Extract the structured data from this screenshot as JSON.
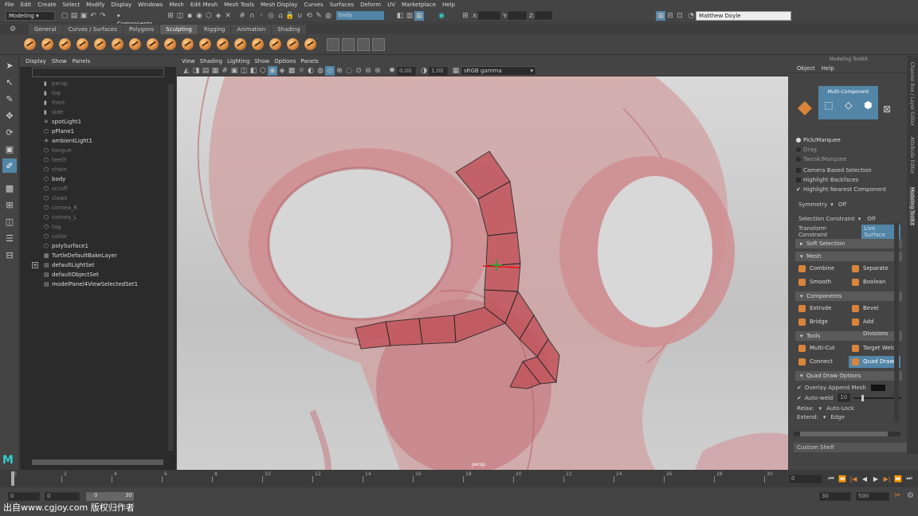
{
  "menus": [
    "File",
    "Edit",
    "Create",
    "Select",
    "Modify",
    "Display",
    "Windows",
    "Mesh",
    "Edit Mesh",
    "Mesh Tools",
    "Mesh Display",
    "Curves",
    "Surfaces",
    "Deform",
    "UV",
    "Marketplace",
    "Help"
  ],
  "status": {
    "workspace": "Modeling",
    "select_mode": "Components",
    "object_field": "body",
    "coord_x_label": "X:",
    "coord_y_label": "Y:",
    "coord_z_label": "Z:",
    "user": "Matthew Doyle"
  },
  "shelf_tabs": [
    "General",
    "Curves / Surfaces",
    "Polygons",
    "Sculpting",
    "Rigging",
    "Animation",
    "Shading"
  ],
  "shelf_active_tab": "Sculpting",
  "outliner": {
    "menus": [
      "Display",
      "Show",
      "Panels"
    ],
    "items": [
      {
        "label": "persp",
        "dim": true,
        "icon": "camera-icon"
      },
      {
        "label": "top",
        "dim": true,
        "icon": "camera-icon"
      },
      {
        "label": "front",
        "dim": true,
        "icon": "camera-icon"
      },
      {
        "label": "side",
        "dim": true,
        "icon": "camera-icon"
      },
      {
        "label": "spotLight1",
        "dim": false,
        "icon": "spotlight-icon"
      },
      {
        "label": "pPlane1",
        "dim": false,
        "icon": "mesh-icon"
      },
      {
        "label": "ambientLight1",
        "dim": false,
        "icon": "sun-icon"
      },
      {
        "label": "tongue",
        "dim": true,
        "icon": "mesh-icon"
      },
      {
        "label": "teeth",
        "dim": true,
        "icon": "mesh-icon"
      },
      {
        "label": "chain",
        "dim": true,
        "icon": "mesh-icon"
      },
      {
        "label": "body",
        "dim": false,
        "icon": "mesh-icon"
      },
      {
        "label": "scruff",
        "dim": true,
        "icon": "mesh-icon"
      },
      {
        "label": "claws",
        "dim": true,
        "icon": "mesh-icon"
      },
      {
        "label": "cornea_R",
        "dim": true,
        "icon": "mesh-icon"
      },
      {
        "label": "cornea_L",
        "dim": true,
        "icon": "mesh-icon"
      },
      {
        "label": "tag",
        "dim": true,
        "icon": "mesh-icon"
      },
      {
        "label": "collar",
        "dim": true,
        "icon": "mesh-icon"
      },
      {
        "label": "polySurface1",
        "dim": false,
        "icon": "mesh-icon"
      },
      {
        "label": "TurtleDefaultBakeLayer",
        "dim": false,
        "icon": "layer-icon"
      },
      {
        "label": "defaultLightSet",
        "dim": false,
        "icon": "set-icon",
        "expand": true
      },
      {
        "label": "defaultObjectSet",
        "dim": false,
        "icon": "set-icon"
      },
      {
        "label": "modelPanel4ViewSelectedSet1",
        "dim": false,
        "icon": "set-icon"
      }
    ]
  },
  "viewport": {
    "menus": [
      "View",
      "Shading",
      "Lighting",
      "Show",
      "Options",
      "Panels"
    ],
    "near_value": "0.00",
    "far_value": "1.00",
    "color_space": "sRGB gamma",
    "camera_label": "persp"
  },
  "toolkit": {
    "title": "Modeling Toolkit",
    "menus": [
      "Object",
      "Help"
    ],
    "mode_label": "Multi-Component",
    "pick_options": [
      {
        "label": "Pick/Marquee",
        "active": true
      },
      {
        "label": "Drag",
        "active": false
      },
      {
        "label": "Tweak/Marquee",
        "active": false
      }
    ],
    "checks": [
      {
        "label": "Camera Based Selection",
        "checked": false
      },
      {
        "label": "Highlight Backfaces",
        "checked": false
      },
      {
        "label": "Highlight Nearest Component",
        "checked": true
      }
    ],
    "symmetry_label": "Symmetry",
    "symmetry_value": "Off",
    "selection_constraint_label": "Selection Constraint",
    "selection_constraint_value": "Off",
    "transform_constraint_label": "Transform Constraint",
    "transform_constraint_value": "Live Surface",
    "soft_selection": "Soft Selection",
    "mesh_header": "Mesh",
    "mesh_buttons": [
      "Combine",
      "Separate",
      "Smooth",
      "Boolean"
    ],
    "components_header": "Components",
    "components_buttons": [
      "Extrude",
      "Bevel",
      "Bridge",
      "Add Divisions"
    ],
    "tools_header": "Tools",
    "tools_buttons": [
      "Multi-Cut",
      "Target Weld",
      "Connect",
      "Quad Draw"
    ],
    "tools_selected": "Quad Draw",
    "quad_header": "Quad Draw Options",
    "overlay_label": "Overlay Append Mesh",
    "autoweld_label": "Auto-weld",
    "autoweld_value": "10",
    "relax_label": "Relax:",
    "relax_value": "Auto-Lock",
    "extend_label": "Extend:",
    "extend_value": "Edge",
    "custom_shelf": "Custom Shelf",
    "side_tabs": [
      "Channel Box / Layer Editor",
      "Attribute Editor",
      "Modeling Toolkit"
    ]
  },
  "timeline": {
    "ticks": [
      "0",
      "2",
      "4",
      "6",
      "8",
      "10",
      "12",
      "14",
      "16",
      "18",
      "20",
      "22",
      "24",
      "26",
      "28",
      "30"
    ],
    "current_frame": "0",
    "start": "0",
    "range_start": "0",
    "range_slider_start": "0",
    "range_slider_end": "30",
    "end": "30",
    "max": "500"
  },
  "watermark": "出自www.cgjoy.com 版权归作者"
}
